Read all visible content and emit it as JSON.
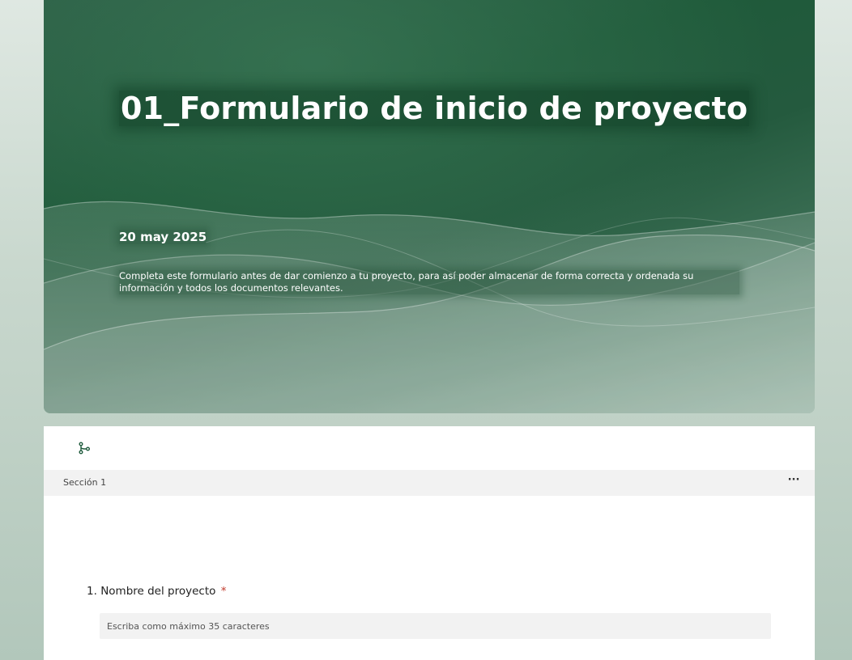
{
  "header": {
    "title": "01_Formulario de inicio de proyecto",
    "date": "20 may 2025",
    "description": "Completa este formulario antes de dar comienzo a tu proyecto, para así poder almacenar de forma correcta y ordenada su información y todos los documentos relevantes."
  },
  "toolbar": {
    "branch_icon": "branching-icon",
    "more_icon": "more-options-icon",
    "more_label": "···"
  },
  "section": {
    "label": "Sección 1"
  },
  "questions": [
    {
      "number": "1.",
      "label": "Nombre del proyecto",
      "required_mark": "*",
      "placeholder": "Escriba como máximo 35 caracteres",
      "value": ""
    }
  ],
  "colors": {
    "theme_green": "#1f5a3a",
    "required_red": "#c0392b",
    "section_bar": "#f2f2f2"
  }
}
